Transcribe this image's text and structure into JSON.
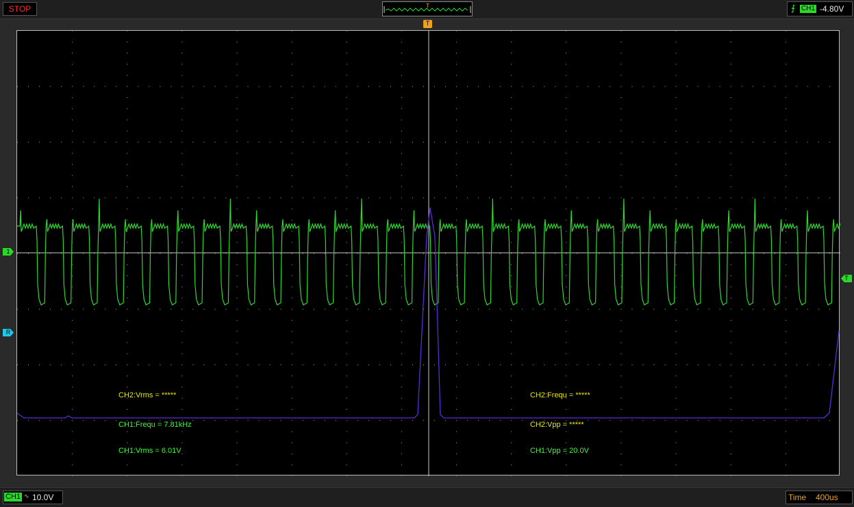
{
  "status": {
    "run_state": "STOP"
  },
  "trigger_overview": {
    "marker": "T"
  },
  "trigger_info": {
    "source": "CH1",
    "level": "-4.80V",
    "edge_icon": "rising-edge-icon"
  },
  "markers": {
    "ch1": "1",
    "ref": "R",
    "trigger_level": "T",
    "trigger_pos": "T"
  },
  "measurements": {
    "ch2_vrms": "CH2:Vrms = *****",
    "ch2_frequ": "CH2:Frequ = *****",
    "ch1_frequ": "CH1:Frequ = 7.81kHz",
    "ch2_vpp": "CH2:Vpp = *****",
    "ch1_vrms": "CH1:Vrms = 6.01V",
    "ch1_vpp": "CH1:Vpp = 20.0V"
  },
  "channel_scale": {
    "channel": "CH1",
    "coupling": "∿",
    "volts_per_div": "10.0V"
  },
  "timebase": {
    "label": "Time",
    "value": "400us"
  },
  "colors": {
    "ch1": "#2bd92b",
    "ch2": "#5b2bd9",
    "ref": "#22c8e8",
    "trigger": "#f0a020",
    "measure_ch2": "#e8e800",
    "measure_ch1": "#33ff33",
    "stop": "#ff2a2a"
  }
}
